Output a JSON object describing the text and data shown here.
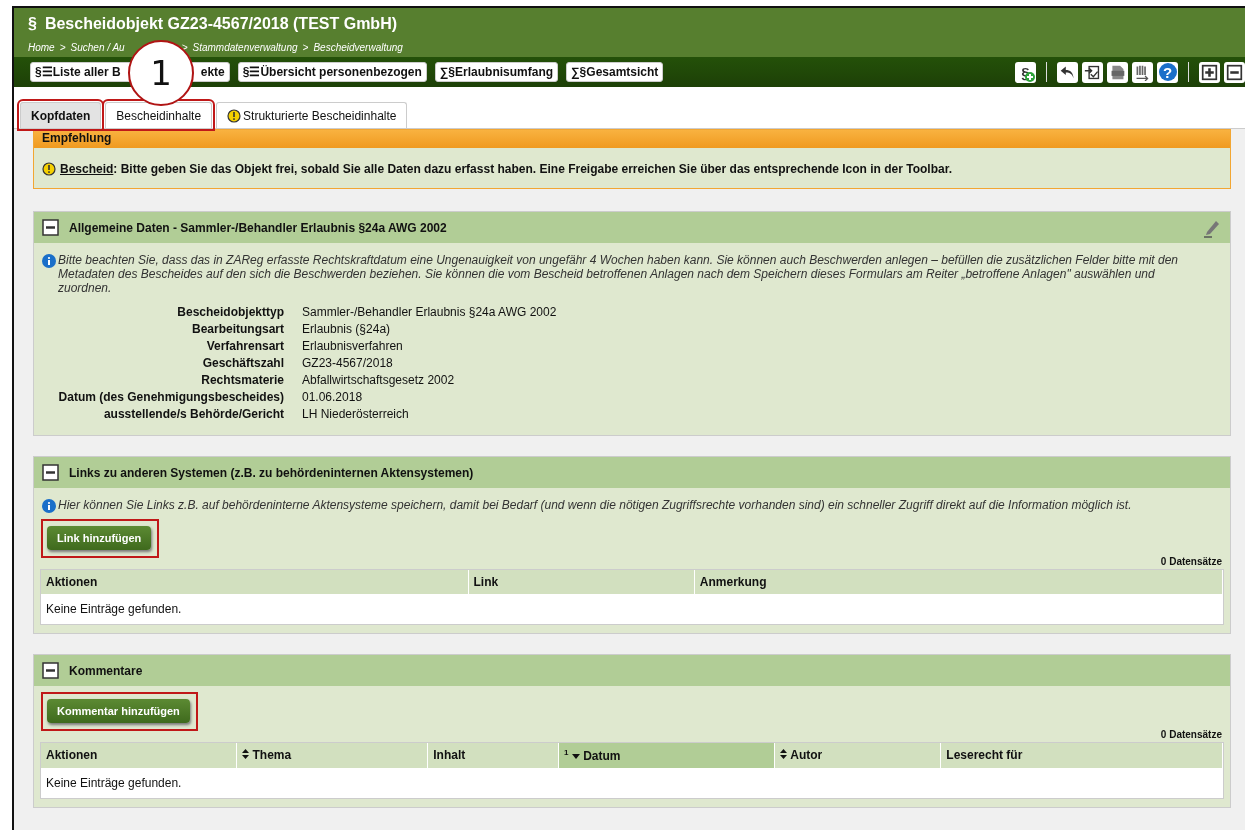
{
  "window": {
    "title": "Bescheidobjekt GZ23-4567/2018 (TEST GmbH)",
    "title_icon": "§"
  },
  "breadcrumb": [
    {
      "label": "Home"
    },
    {
      "separator": ">",
      "label": "Suchen / Au"
    },
    {
      "separator": ">",
      "label": "Stammdatenverwaltung"
    },
    {
      "separator": ">",
      "label": "Bescheidverwaltung"
    }
  ],
  "toolbar": {
    "buttons": [
      {
        "icon": "§☰",
        "parts": [
          "Liste aller B",
          "ekte"
        ]
      },
      {
        "icon": "§☰",
        "parts": [
          "Übersicht personenbezogen"
        ]
      },
      {
        "icon": "∑§",
        "parts": [
          "Erlaubnisumfang"
        ]
      },
      {
        "icon": "∑§",
        "parts": [
          "Gesamtsicht"
        ]
      }
    ],
    "icons": [
      {
        "kind": "para-add",
        "glyph": "§"
      },
      {
        "kind": "sep"
      },
      {
        "kind": "undo"
      },
      {
        "kind": "import"
      },
      {
        "kind": "pdf"
      },
      {
        "kind": "export"
      },
      {
        "kind": "help",
        "glyph": "?"
      },
      {
        "kind": "sep"
      },
      {
        "kind": "expand"
      },
      {
        "kind": "collapse"
      }
    ]
  },
  "callout": {
    "number": "1"
  },
  "tabs": [
    {
      "label": "Kopfdaten",
      "selected": true,
      "warning": false,
      "highlighted": true
    },
    {
      "label": "Bescheidinhalte",
      "selected": false,
      "warning": false,
      "highlighted": true
    },
    {
      "label": "Strukturierte Bescheidinhalte",
      "selected": false,
      "warning": true,
      "highlighted": false
    }
  ],
  "recommendation": {
    "title": "Empfehlung",
    "link": "Bescheid",
    "text": ": Bitte geben Sie das Objekt frei, sobald Sie alle Daten dazu erfasst haben. Eine Freigabe erreichen Sie über das entsprechende Icon in der Toolbar."
  },
  "panels": [
    {
      "kind": "details",
      "title": "Allgemeine Daten - Sammler-/Behandler Erlaubnis §24a AWG 2002",
      "expanded": true,
      "editable": true,
      "info": "Bitte beachten Sie, dass das in ZAReg erfasste Rechtskraftdatum eine Ungenauigkeit von ungefähr 4 Wochen haben kann. Sie können auch Beschwerden anlegen – befüllen die zusätzlichen Felder bitte mit den Metadaten des Bescheides auf den sich die Beschwerden beziehen. Sie können die vom Bescheid betroffenen Anlagen nach dem Speichern dieses Formulars am Reiter „betroffene Anlagen\" auswählen und zuordnen.",
      "fields": [
        {
          "label": "Bescheidobjekttyp",
          "value": "Sammler-/Behandler Erlaubnis §24a AWG 2002"
        },
        {
          "label": "Bearbeitungsart",
          "value": "Erlaubnis (§24a)"
        },
        {
          "label": "Verfahrensart",
          "value": "Erlaubnisverfahren"
        },
        {
          "label": "Geschäftszahl",
          "value": "GZ23-4567/2018"
        },
        {
          "label": "Rechtsmaterie",
          "value": "Abfallwirtschaftsgesetz 2002"
        },
        {
          "label": "Datum (des Genehmigungsbescheides)",
          "value": "01.06.2018"
        },
        {
          "label": "ausstellende/s Behörde/Gericht",
          "value": "LH Niederösterreich"
        }
      ]
    },
    {
      "kind": "table",
      "title": "Links zu anderen Systemen (z.B. zu behördeninternen Aktensystemen)",
      "expanded": true,
      "editable": false,
      "info": "Hier können Sie Links z.B. auf behördeninterne Aktensysteme speichern, damit bei Bedarf (und wenn die nötigen Zugriffsrechte vorhanden sind) ein schneller Zugriff direkt auf die Information möglich ist.",
      "button": {
        "label": "Link hinzufügen",
        "highlighted": true
      },
      "count": "0 Datensätze",
      "columns": [
        {
          "label": "Aktionen",
          "sortable": false,
          "sorted": false
        },
        {
          "label": "Link",
          "sortable": false,
          "sorted": false
        },
        {
          "label": "Anmerkung",
          "sortable": false,
          "sorted": false
        }
      ],
      "empty": "Keine Einträge gefunden."
    },
    {
      "kind": "table",
      "title": "Kommentare",
      "expanded": true,
      "editable": false,
      "button": {
        "label": "Kommentar hinzufügen",
        "highlighted": true
      },
      "count": "0 Datensätze",
      "columns": [
        {
          "label": "Aktionen",
          "sortable": false,
          "sorted": false
        },
        {
          "label": "Thema",
          "sortable": true,
          "sorted": false
        },
        {
          "label": "Inhalt",
          "sortable": false,
          "sorted": false
        },
        {
          "label": "Datum",
          "sortable": true,
          "sorted": true,
          "rank": "1"
        },
        {
          "label": "Autor",
          "sortable": true,
          "sorted": false
        },
        {
          "label": "Leserecht für",
          "sortable": false,
          "sorted": false
        }
      ],
      "empty": "Keine Einträge gefunden."
    }
  ]
}
